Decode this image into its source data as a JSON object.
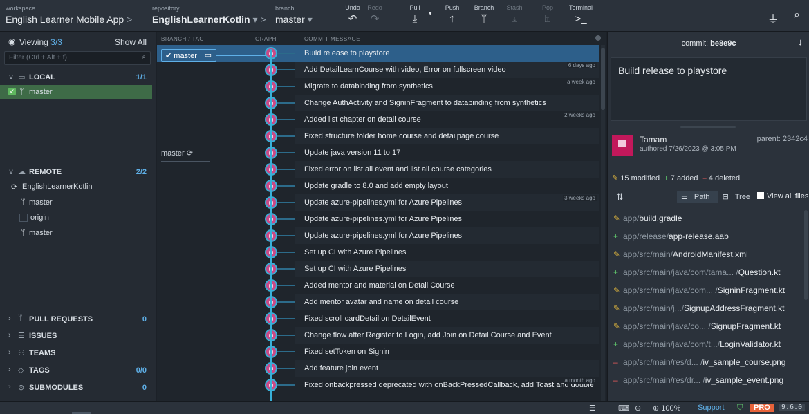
{
  "toolbar": {
    "workspace_label": "workspace",
    "workspace_name": "English Learner Mobile App",
    "repository_label": "repository",
    "repository_name": "EnglishLearnerKotlin",
    "branch_label": "branch",
    "branch_name": "master",
    "undo": "Undo",
    "redo": "Redo",
    "pull": "Pull",
    "push": "Push",
    "branch_btn": "Branch",
    "stash": "Stash",
    "pop": "Pop",
    "terminal": "Terminal"
  },
  "left": {
    "viewing_label": "Viewing",
    "viewing_count": "3/3",
    "show_all": "Show All",
    "filter_placeholder": "Filter (Ctrl + Alt + f)",
    "local_title": "LOCAL",
    "local_count": "1/1",
    "local_branch": "master",
    "remote_title": "REMOTE",
    "remote_count": "2/2",
    "remote_repo": "EnglishLearnerKotlin",
    "remote_branch1": "master",
    "origin": "origin",
    "origin_branch": "master",
    "pull_requests": "PULL REQUESTS",
    "pull_requests_count": "0",
    "issues": "ISSUES",
    "teams": "TEAMS",
    "tags": "TAGS",
    "tags_count": "0/0",
    "submodules": "SUBMODULES",
    "submodules_count": "0"
  },
  "graph": {
    "col_branch": "BRANCH / TAG",
    "col_graph": "GRAPH",
    "col_msg": "COMMIT MESSAGE",
    "local_tag": "master",
    "remote_tag": "master",
    "commits": [
      {
        "msg": "Build release to playstore",
        "time": ""
      },
      {
        "msg": "Add DetailLearnCourse with video, Error on fullscreen video",
        "time": "6 days ago"
      },
      {
        "msg": "Migrate to databinding from synthetics",
        "time": "a week ago"
      },
      {
        "msg": "Change AuthActivity and SigninFragment to databinding from synthetics",
        "time": ""
      },
      {
        "msg": "Added list chapter on detail course",
        "time": "2 weeks ago"
      },
      {
        "msg": "Fixed structure folder home course and detailpage course",
        "time": ""
      },
      {
        "msg": "Update java version 11 to 17",
        "time": ""
      },
      {
        "msg": "Fixed error on list all event and list all course categories",
        "time": ""
      },
      {
        "msg": "Update gradle to 8.0 and add empty layout",
        "time": ""
      },
      {
        "msg": "Update azure-pipelines.yml for Azure Pipelines",
        "time": "3 weeks ago"
      },
      {
        "msg": "Update azure-pipelines.yml for Azure Pipelines",
        "time": ""
      },
      {
        "msg": "Update azure-pipelines.yml for Azure Pipelines",
        "time": ""
      },
      {
        "msg": "Set up CI with Azure Pipelines",
        "time": ""
      },
      {
        "msg": "Set up CI with Azure Pipelines",
        "time": ""
      },
      {
        "msg": "Added mentor and material on Detail Course",
        "time": ""
      },
      {
        "msg": "Add mentor avatar and name on detail course",
        "time": ""
      },
      {
        "msg": "Fixed scroll cardDetail on DetailEvent",
        "time": ""
      },
      {
        "msg": "Change flow after Register to Login, add Join on Detail Course and Event",
        "time": ""
      },
      {
        "msg": "Fixed setToken on Signin",
        "time": ""
      },
      {
        "msg": "Add feature join event",
        "time": ""
      },
      {
        "msg": "Fixed onbackpressed deprecated with onBackPressedCallback, add Toast and double cli...",
        "time": "a month ago"
      }
    ]
  },
  "right": {
    "commit_label": "commit:",
    "commit_sha": "be8e9c",
    "message": "Build release to playstore",
    "author": "Tamam",
    "authored": "authored 7/26/2023 @ 3:05 PM",
    "parent_label": "parent:",
    "parent_sha": "2342c4",
    "modified": "15 modified",
    "added": "7 added",
    "deleted": "4 deleted",
    "path_btn": "Path",
    "tree_btn": "Tree",
    "view_all": "View all files",
    "files": [
      {
        "kind": "mod",
        "dir": "app/",
        "name": "build.gradle"
      },
      {
        "kind": "add",
        "dir": "app/release/",
        "name": "app-release.aab"
      },
      {
        "kind": "mod",
        "dir": "app/src/main/",
        "name": "AndroidManifest.xml"
      },
      {
        "kind": "add",
        "dir": "app/src/main/java/com/tama...  /",
        "name": "Question.kt"
      },
      {
        "kind": "mod",
        "dir": "app/src/main/java/com... /",
        "name": "SigninFragment.kt"
      },
      {
        "kind": "mod",
        "dir": "app/src/main/j.../",
        "name": "SignupAddressFragment.kt"
      },
      {
        "kind": "mod",
        "dir": "app/src/main/java/co...  /",
        "name": "SignupFragment.kt"
      },
      {
        "kind": "add",
        "dir": "app/src/main/java/com/t.../",
        "name": "LoginValidator.kt"
      },
      {
        "kind": "del",
        "dir": "app/src/main/res/d... /",
        "name": "iv_sample_course.png"
      },
      {
        "kind": "del",
        "dir": "app/src/main/res/dr... /",
        "name": "iv_sample_event.png"
      }
    ]
  },
  "status": {
    "zoom": "100%",
    "support": "Support",
    "pro": "PRO",
    "version": "9.6.0"
  }
}
